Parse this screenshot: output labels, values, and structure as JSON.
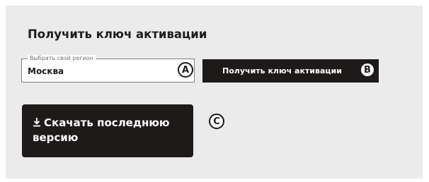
{
  "title": "Получить ключ активации",
  "region": {
    "legend": "Выбрать свой регион",
    "value": "Москва"
  },
  "get_key_button": {
    "label": "Получить ключ активации"
  },
  "download_button": {
    "icon": "download-icon",
    "label": "Скачать последнюю версию"
  },
  "markers": {
    "a": "A",
    "b": "B",
    "c": "C"
  },
  "colors": {
    "background": "#ebebeb",
    "button": "#1f1a1a",
    "button_text": "#ffffff"
  }
}
